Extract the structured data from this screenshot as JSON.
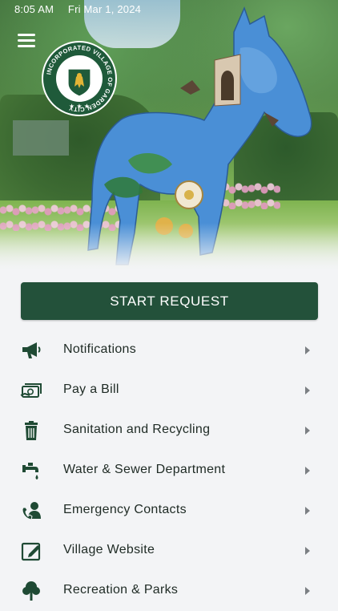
{
  "status_bar": {
    "time": "8:05 AM",
    "date": "Fri Mar 1, 2024"
  },
  "header": {
    "seal": {
      "ring_text": "INCORPORATED VILLAGE OF GARDEN CITY"
    },
    "horse_emblem_text": "VILLAGE OF GARDEN CITY"
  },
  "start_request": {
    "label": "START REQUEST"
  },
  "menu": [
    {
      "label": "Notifications",
      "icon": "megaphone-icon"
    },
    {
      "label": "Pay a Bill",
      "icon": "bill-payment-icon"
    },
    {
      "label": "Sanitation and Recycling",
      "icon": "trash-can-icon"
    },
    {
      "label": "Water & Sewer Department",
      "icon": "faucet-icon"
    },
    {
      "label": "Emergency Contacts",
      "icon": "emergency-contact-icon"
    },
    {
      "label": "Village Website",
      "icon": "edit-website-icon"
    },
    {
      "label": "Recreation & Parks",
      "icon": "tree-icon"
    }
  ],
  "colors": {
    "brand_green": "#23513a",
    "icon_green": "#1f4a34",
    "chevron": "#7b7f83"
  }
}
